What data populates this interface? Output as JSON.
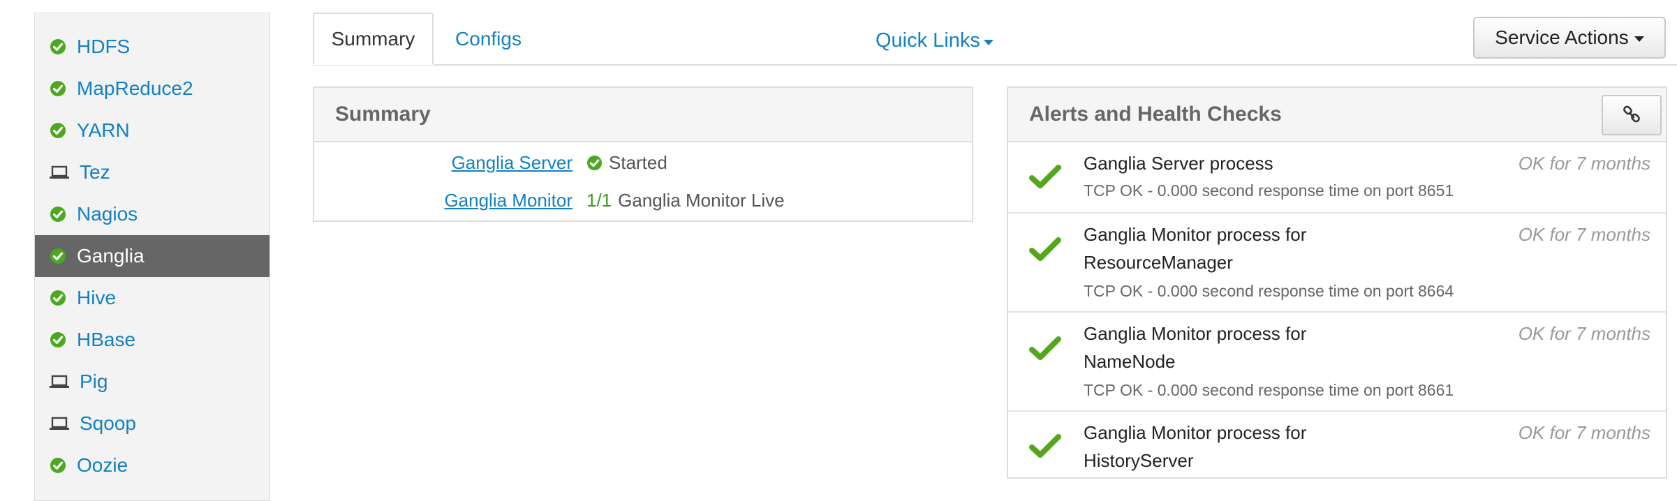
{
  "sidebar": {
    "items": [
      {
        "label": "HDFS",
        "icon": "check-circle-icon"
      },
      {
        "label": "MapReduce2",
        "icon": "check-circle-icon"
      },
      {
        "label": "YARN",
        "icon": "check-circle-icon"
      },
      {
        "label": "Tez",
        "icon": "laptop-icon"
      },
      {
        "label": "Nagios",
        "icon": "check-circle-icon"
      },
      {
        "label": "Ganglia",
        "icon": "check-circle-icon",
        "active": true
      },
      {
        "label": "Hive",
        "icon": "check-circle-icon"
      },
      {
        "label": "HBase",
        "icon": "check-circle-icon"
      },
      {
        "label": "Pig",
        "icon": "laptop-icon"
      },
      {
        "label": "Sqoop",
        "icon": "laptop-icon"
      },
      {
        "label": "Oozie",
        "icon": "check-circle-icon"
      }
    ]
  },
  "tabs": {
    "summary": "Summary",
    "configs": "Configs"
  },
  "quick_links": "Quick Links",
  "service_actions": "Service Actions",
  "summary_panel": {
    "title": "Summary",
    "rows": [
      {
        "link": "Ganglia Server",
        "status": "Started"
      },
      {
        "link": "Ganglia Monitor",
        "count": "1/1",
        "status": "Ganglia Monitor Live"
      }
    ]
  },
  "alerts_panel": {
    "title": "Alerts and Health Checks",
    "alerts": [
      {
        "line1": "Ganglia Server process",
        "line2": "",
        "detail": "TCP OK - 0.000 second response time on port 8651",
        "status": "OK for 7 months"
      },
      {
        "line1": "Ganglia Monitor process for",
        "line2": "ResourceManager",
        "detail": "TCP OK - 0.000 second response time on port 8664",
        "status": "OK for 7 months"
      },
      {
        "line1": "Ganglia Monitor process for",
        "line2": "NameNode",
        "detail": "TCP OK - 0.000 second response time on port 8661",
        "status": "OK for 7 months"
      },
      {
        "line1": "Ganglia Monitor process for",
        "line2": "HistoryServer",
        "detail": "",
        "status": "OK for 7 months"
      }
    ]
  },
  "colors": {
    "link_blue": "#1380c4",
    "ok_green": "#4ca81f",
    "active_sidebar_bg": "#666666"
  }
}
